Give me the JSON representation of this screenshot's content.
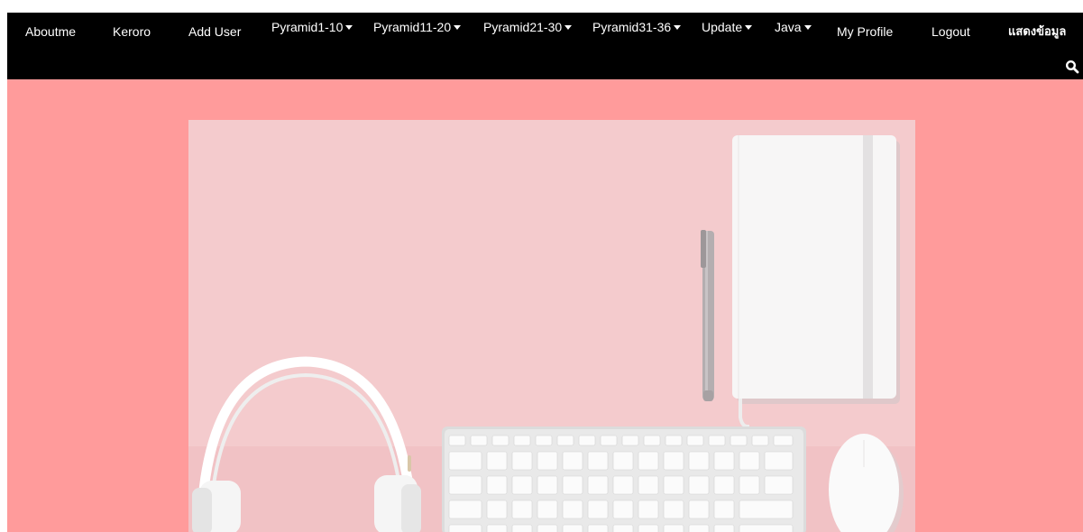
{
  "nav": {
    "items": [
      {
        "label": "Aboutme",
        "dropdown": false
      },
      {
        "label": "Keroro",
        "dropdown": false
      },
      {
        "label": "Add User",
        "dropdown": false
      },
      {
        "label": "Pyramid1-10",
        "dropdown": true
      },
      {
        "label": "Pyramid11-20",
        "dropdown": true
      },
      {
        "label": "Pyramid21-30",
        "dropdown": true
      },
      {
        "label": "Pyramid31-36",
        "dropdown": true
      },
      {
        "label": "Update",
        "dropdown": true
      },
      {
        "label": "Java",
        "dropdown": true
      },
      {
        "label": "My Profile",
        "dropdown": false
      },
      {
        "label": "Logout",
        "dropdown": false
      },
      {
        "label": "แสดงข้อมูล",
        "dropdown": false
      }
    ],
    "search_icon": "search-icon"
  },
  "colors": {
    "navbar_bg": "#000000",
    "nav_text": "#ffffff",
    "page_bg": "#ff9b9b",
    "hero_bg": "#f3c6c9"
  },
  "hero": {
    "image_subject": "pink desk flat lay with headphones, keyboard, mouse, pen and notebook"
  }
}
